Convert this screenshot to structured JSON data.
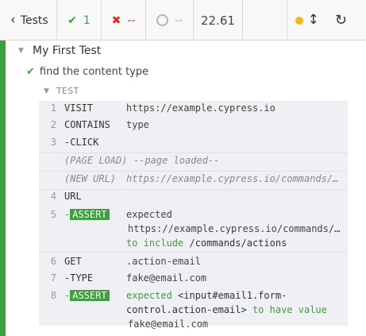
{
  "toolbar": {
    "tests_label": "Tests",
    "passed": "1",
    "failed": "--",
    "pending": "--",
    "duration": "22.61"
  },
  "colors": {
    "pass": "#3f9e3f",
    "fail": "#e2281f",
    "running_dot": "#f5b31e"
  },
  "icons": [
    "chevron-left-icon",
    "check-icon",
    "x-icon",
    "ring-icon",
    "dot-icon",
    "up-down-icon",
    "refresh-icon",
    "triangle-down-icon"
  ],
  "suite": {
    "title": "My First Test"
  },
  "test": {
    "title": "find the content type"
  },
  "hook": {
    "label": "TEST"
  },
  "commands": [
    {
      "num": "1",
      "name": "VISIT",
      "message": "https://example.cypress.io"
    },
    {
      "num": "2",
      "name": "CONTAINS",
      "message": "type"
    },
    {
      "num": "3",
      "name": "-CLICK",
      "message": ""
    },
    {
      "num": "",
      "name": "(PAGE LOAD)",
      "message": "--page loaded--"
    },
    {
      "num": "",
      "name": "(NEW URL)",
      "message": "https://example.cypress.io/commands/…"
    },
    {
      "num": "4",
      "name": "URL",
      "message": ""
    },
    {
      "num": "5",
      "name": "-ASSERT",
      "message_lines": [
        "expected",
        "https://example.cypress.io/commands/…",
        "to include /commands/actions"
      ]
    },
    {
      "num": "6",
      "name": "GET",
      "message": ".action-email"
    },
    {
      "num": "7",
      "name": "-TYPE",
      "message": "fake@email.com"
    },
    {
      "num": "8",
      "name": "-ASSERT",
      "message_lines": [
        "expected <input#email1.form-",
        "control.action-email> to have value",
        "fake@email.com"
      ]
    }
  ],
  "assert5": {
    "expected": "expected",
    "url": "https://example.cypress.io/commands/…",
    "to_include": "to include",
    "value": "/commands/actions"
  },
  "assert8": {
    "expected": "expected",
    "el1": "<input#email1.form-",
    "el2": "control.action-email>",
    "to_have": "to have value",
    "value": "fake@email.com"
  }
}
